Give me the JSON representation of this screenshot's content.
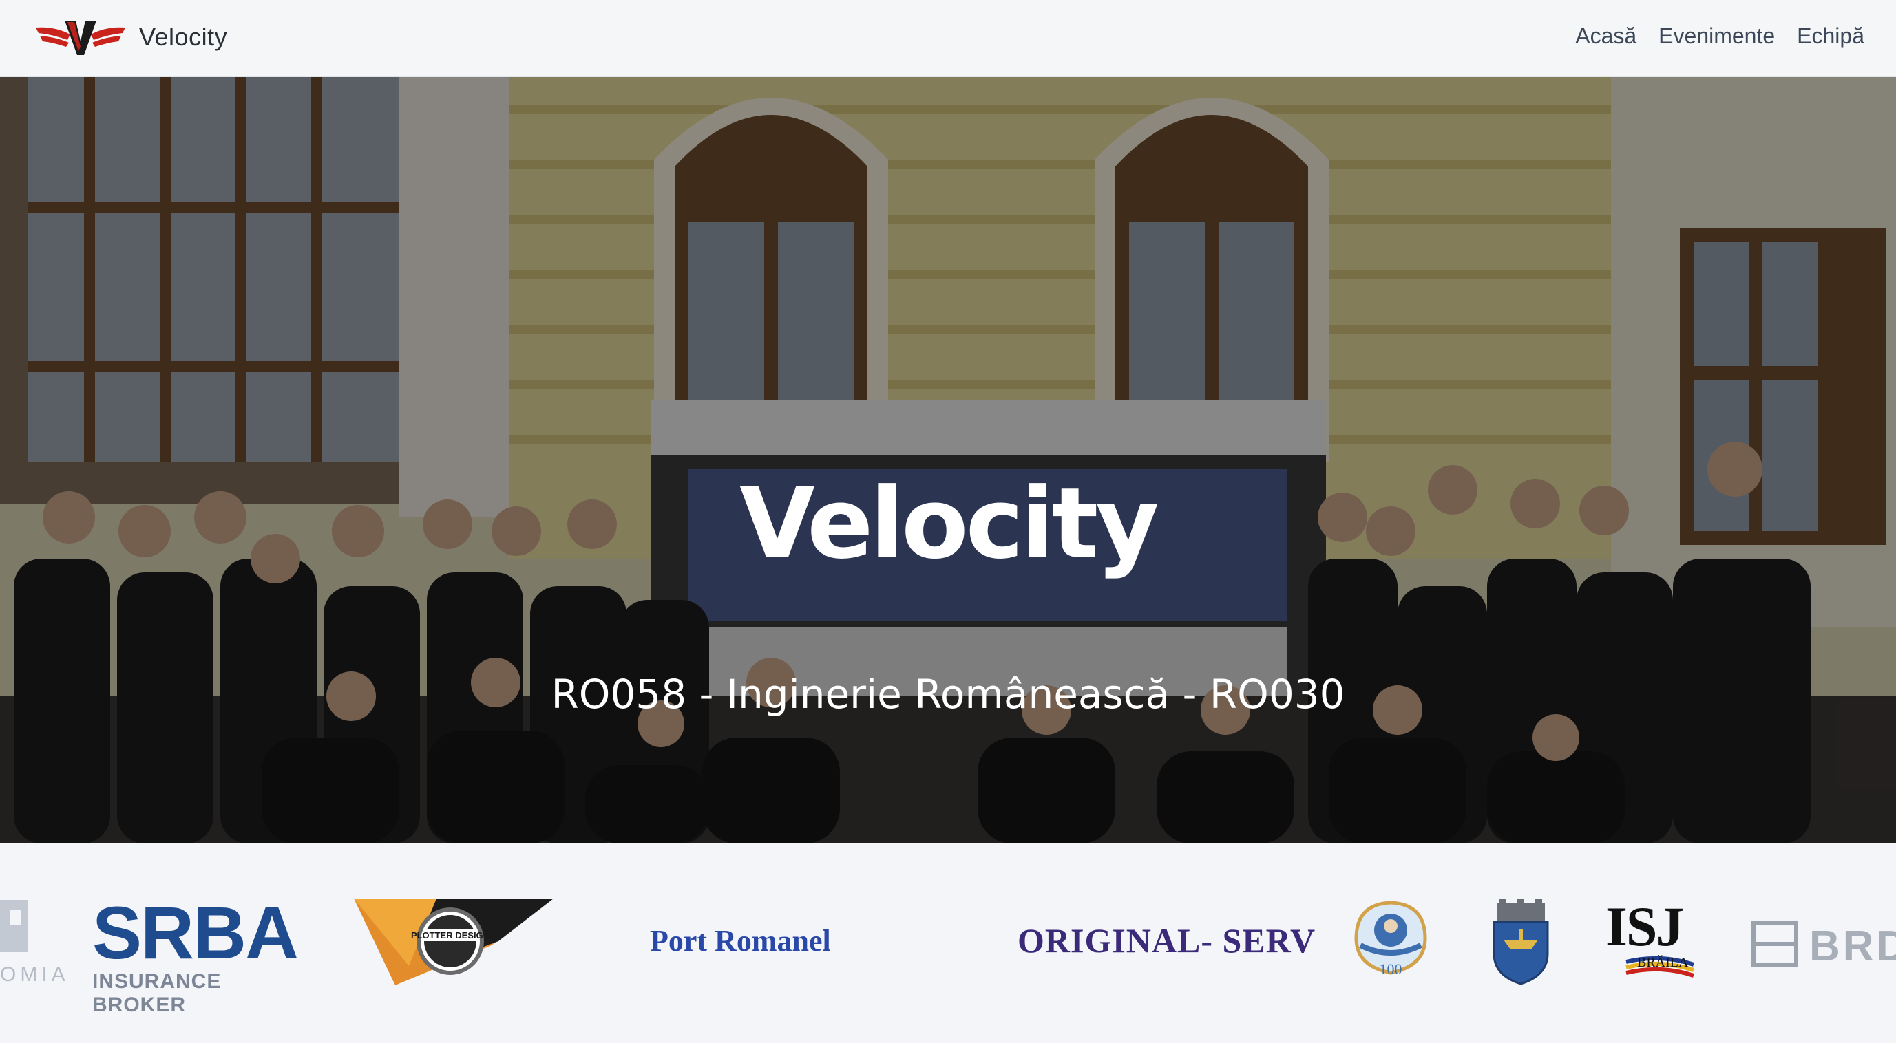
{
  "brand": {
    "name": "Velocity",
    "logo_icon": "velocity-winged-v-logo"
  },
  "nav": {
    "items": [
      "Acasă",
      "Evenimente",
      "Echipă"
    ]
  },
  "hero": {
    "title": "Velocity",
    "subtitle": "RO058 - Inginerie Românească - RO030",
    "overlay_color": "rgba(0,0,0,0.42)"
  },
  "sponsors": {
    "items": [
      {
        "name": "partial-left-logo",
        "text": "OMIA"
      },
      {
        "name": "srba",
        "text": "SRBA",
        "subtext": "INSURANCE BROKER"
      },
      {
        "name": "plotter-design",
        "text": "PLOTTER DESIGN"
      },
      {
        "name": "port-romanel",
        "text": "Port Romanel"
      },
      {
        "name": "original-serv",
        "text": "ORIGINAL- SERV"
      },
      {
        "name": "college-centenary-seal",
        "text": "100"
      },
      {
        "name": "braila-coat-of-arms",
        "text": ""
      },
      {
        "name": "isj-braila",
        "text": "ISJ",
        "subtext": "BRĂILA"
      },
      {
        "name": "brd-partial",
        "text": "BRD"
      }
    ]
  },
  "colors": {
    "navbar_bg": "#f4f6f8",
    "page_bg": "#f3f5f8",
    "logo_red": "#c9231c",
    "srba_blue": "#1f4b8f",
    "port_romanel_blue": "#2a48a8",
    "original_serv_purple": "#3b2a7a"
  }
}
